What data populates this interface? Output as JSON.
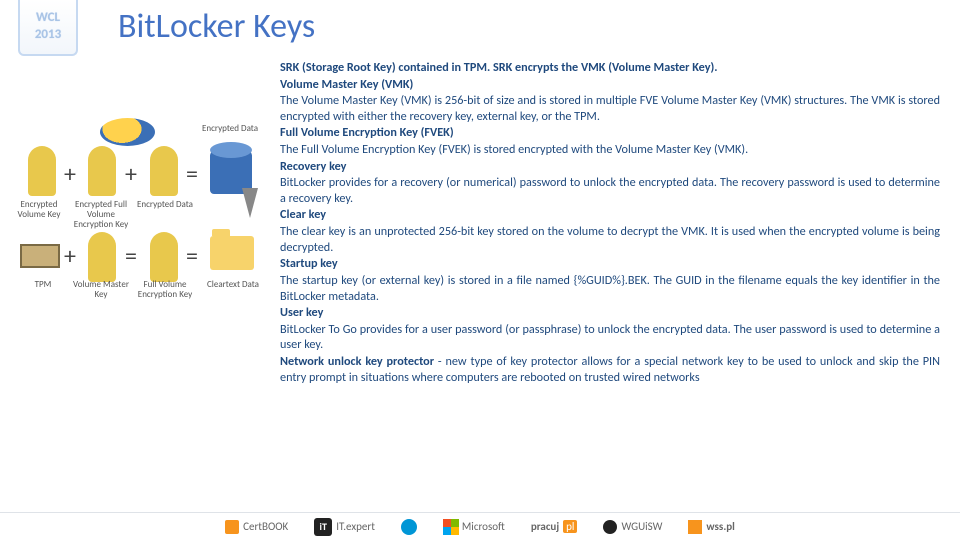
{
  "badge": {
    "line1": "WCL",
    "line2": "2013"
  },
  "title": "BitLocker Keys",
  "diagram": {
    "labels": {
      "evk": "Encrypted Volume Key",
      "efvek": "Encrypted Full Volume Encryption Key",
      "ed": "Encrypted Data",
      "tpm": "TPM",
      "vmk": "Volume Master Key",
      "fvek": "Full Volume Encryption Key",
      "ct": "Cleartext Data"
    }
  },
  "sections": [
    {
      "heading": null,
      "body": "SRK (Storage Root Key) contained in TPM. SRK encrypts the VMK (Volume Master Key)."
    },
    {
      "heading": "Volume Master Key (VMK)",
      "body": "The Volume Master Key (VMK) is 256-bit of size and is stored in multiple FVE Volume Master Key (VMK) structures. The VMK is stored encrypted with either the recovery key, external key, or the TPM."
    },
    {
      "heading": "Full Volume Encryption Key (FVEK)",
      "body": "The Full Volume Encryption Key (FVEK) is stored encrypted with the Volume Master Key (VMK)."
    },
    {
      "heading": "Recovery key",
      "body": "BitLocker provides for a recovery (or numerical) password to unlock the encrypted data. The recovery password is used to determine a recovery key."
    },
    {
      "heading": "Clear key",
      "body": "The clear key is an unprotected 256-bit key stored on the volume to decrypt the VMK. It is used when the encrypted volume is being decrypted."
    },
    {
      "heading": "Startup key",
      "body": "The startup key (or external key) is stored in a file named {%GUID%}.BEK. The GUID in the filename equals the key identifier in the BitLocker metadata."
    },
    {
      "heading": "User key",
      "body": "BitLocker To Go provides for a user password (or passphrase) to unlock the encrypted data. The user password is used to determine a user key."
    },
    {
      "heading": null,
      "body": "Network unlock key protector  - new type of key protector allows for a special network key to be used to unlock and skip the PIN entry prompt in situations where computers are rebooted on trusted wired networks"
    }
  ],
  "footer": {
    "certbook": "CertBOOK",
    "it": "iT",
    "itexpert": "IT.expert",
    "microsoft": "Microsoft",
    "pracuj": "pracuj",
    "pracuj_suffix": "pl",
    "wguisw": "WGUiSW",
    "wss": "wss.pl"
  }
}
